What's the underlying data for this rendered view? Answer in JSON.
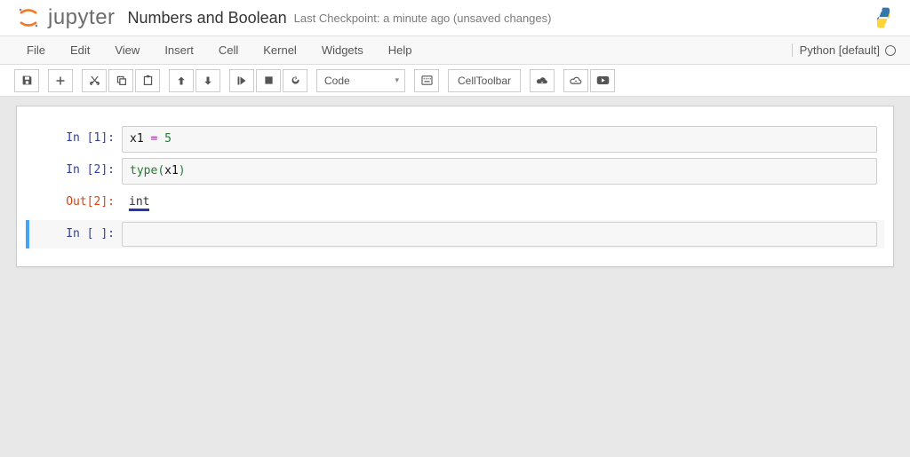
{
  "header": {
    "logo_text": "jupyter",
    "notebook_title": "Numbers and Boolean",
    "checkpoint": "Last Checkpoint: a minute ago (unsaved changes)"
  },
  "menubar": {
    "items": [
      "File",
      "Edit",
      "View",
      "Insert",
      "Cell",
      "Kernel",
      "Widgets",
      "Help"
    ],
    "kernel_name": "Python [default]"
  },
  "toolbar": {
    "cell_type": "Code",
    "cell_toolbar_label": "CellToolbar"
  },
  "cells": [
    {
      "in_prompt": "In [1]:",
      "code_html": "<span class='tok-name'>x1</span> <span class='tok-op'>=</span> <span class='tok-num'>5</span>"
    },
    {
      "in_prompt": "In [2]:",
      "code_html": "<span class='tok-builtin'>type</span><span class='tok-punct'>(</span><span class='tok-name'>x1</span><span class='tok-punct'>)</span>",
      "out_prompt": "Out[2]:",
      "output": "int"
    },
    {
      "in_prompt": "In [ ]:",
      "code_html": "",
      "selected": true
    }
  ]
}
